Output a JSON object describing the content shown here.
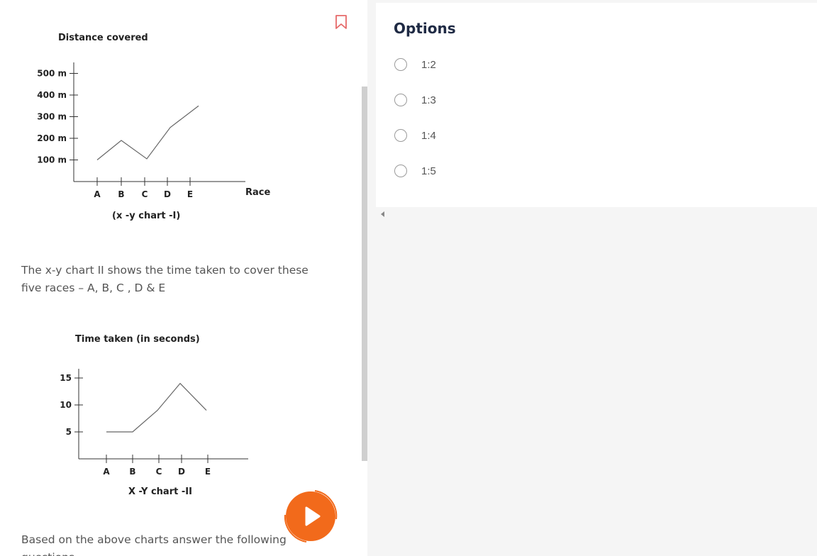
{
  "chart_data": [
    {
      "type": "line",
      "title": "Distance covered",
      "xlabel": "Race",
      "caption": "(x -y chart -I)",
      "categories": [
        "A",
        "B",
        "C",
        "D",
        "E"
      ],
      "y_ticks": [
        "500 m",
        "400 m",
        "300 m",
        "200 m",
        "100 m"
      ],
      "values": [
        100,
        190,
        105,
        250,
        350
      ],
      "ylim": [
        0,
        500
      ]
    },
    {
      "type": "line",
      "title": "Time taken (in seconds)",
      "caption": "X -Y chart -II",
      "categories": [
        "A",
        "B",
        "C",
        "D",
        "E"
      ],
      "y_ticks": [
        "15",
        "10",
        "5"
      ],
      "values": [
        5,
        5,
        9,
        14,
        9
      ],
      "ylim": [
        0,
        18
      ]
    }
  ],
  "question": {
    "para1": "The x-y chart II shows the time taken to cover these five races – A, B, C , D & E",
    "para2": "Based on the above charts answer the following questions"
  },
  "options": {
    "title": "Options",
    "items": [
      "1:2",
      "1:3",
      "1:4",
      "1:5"
    ]
  },
  "colors": {
    "bookmark": "#e66a6a",
    "play": "#f26a1b",
    "title": "#1f2a44"
  }
}
